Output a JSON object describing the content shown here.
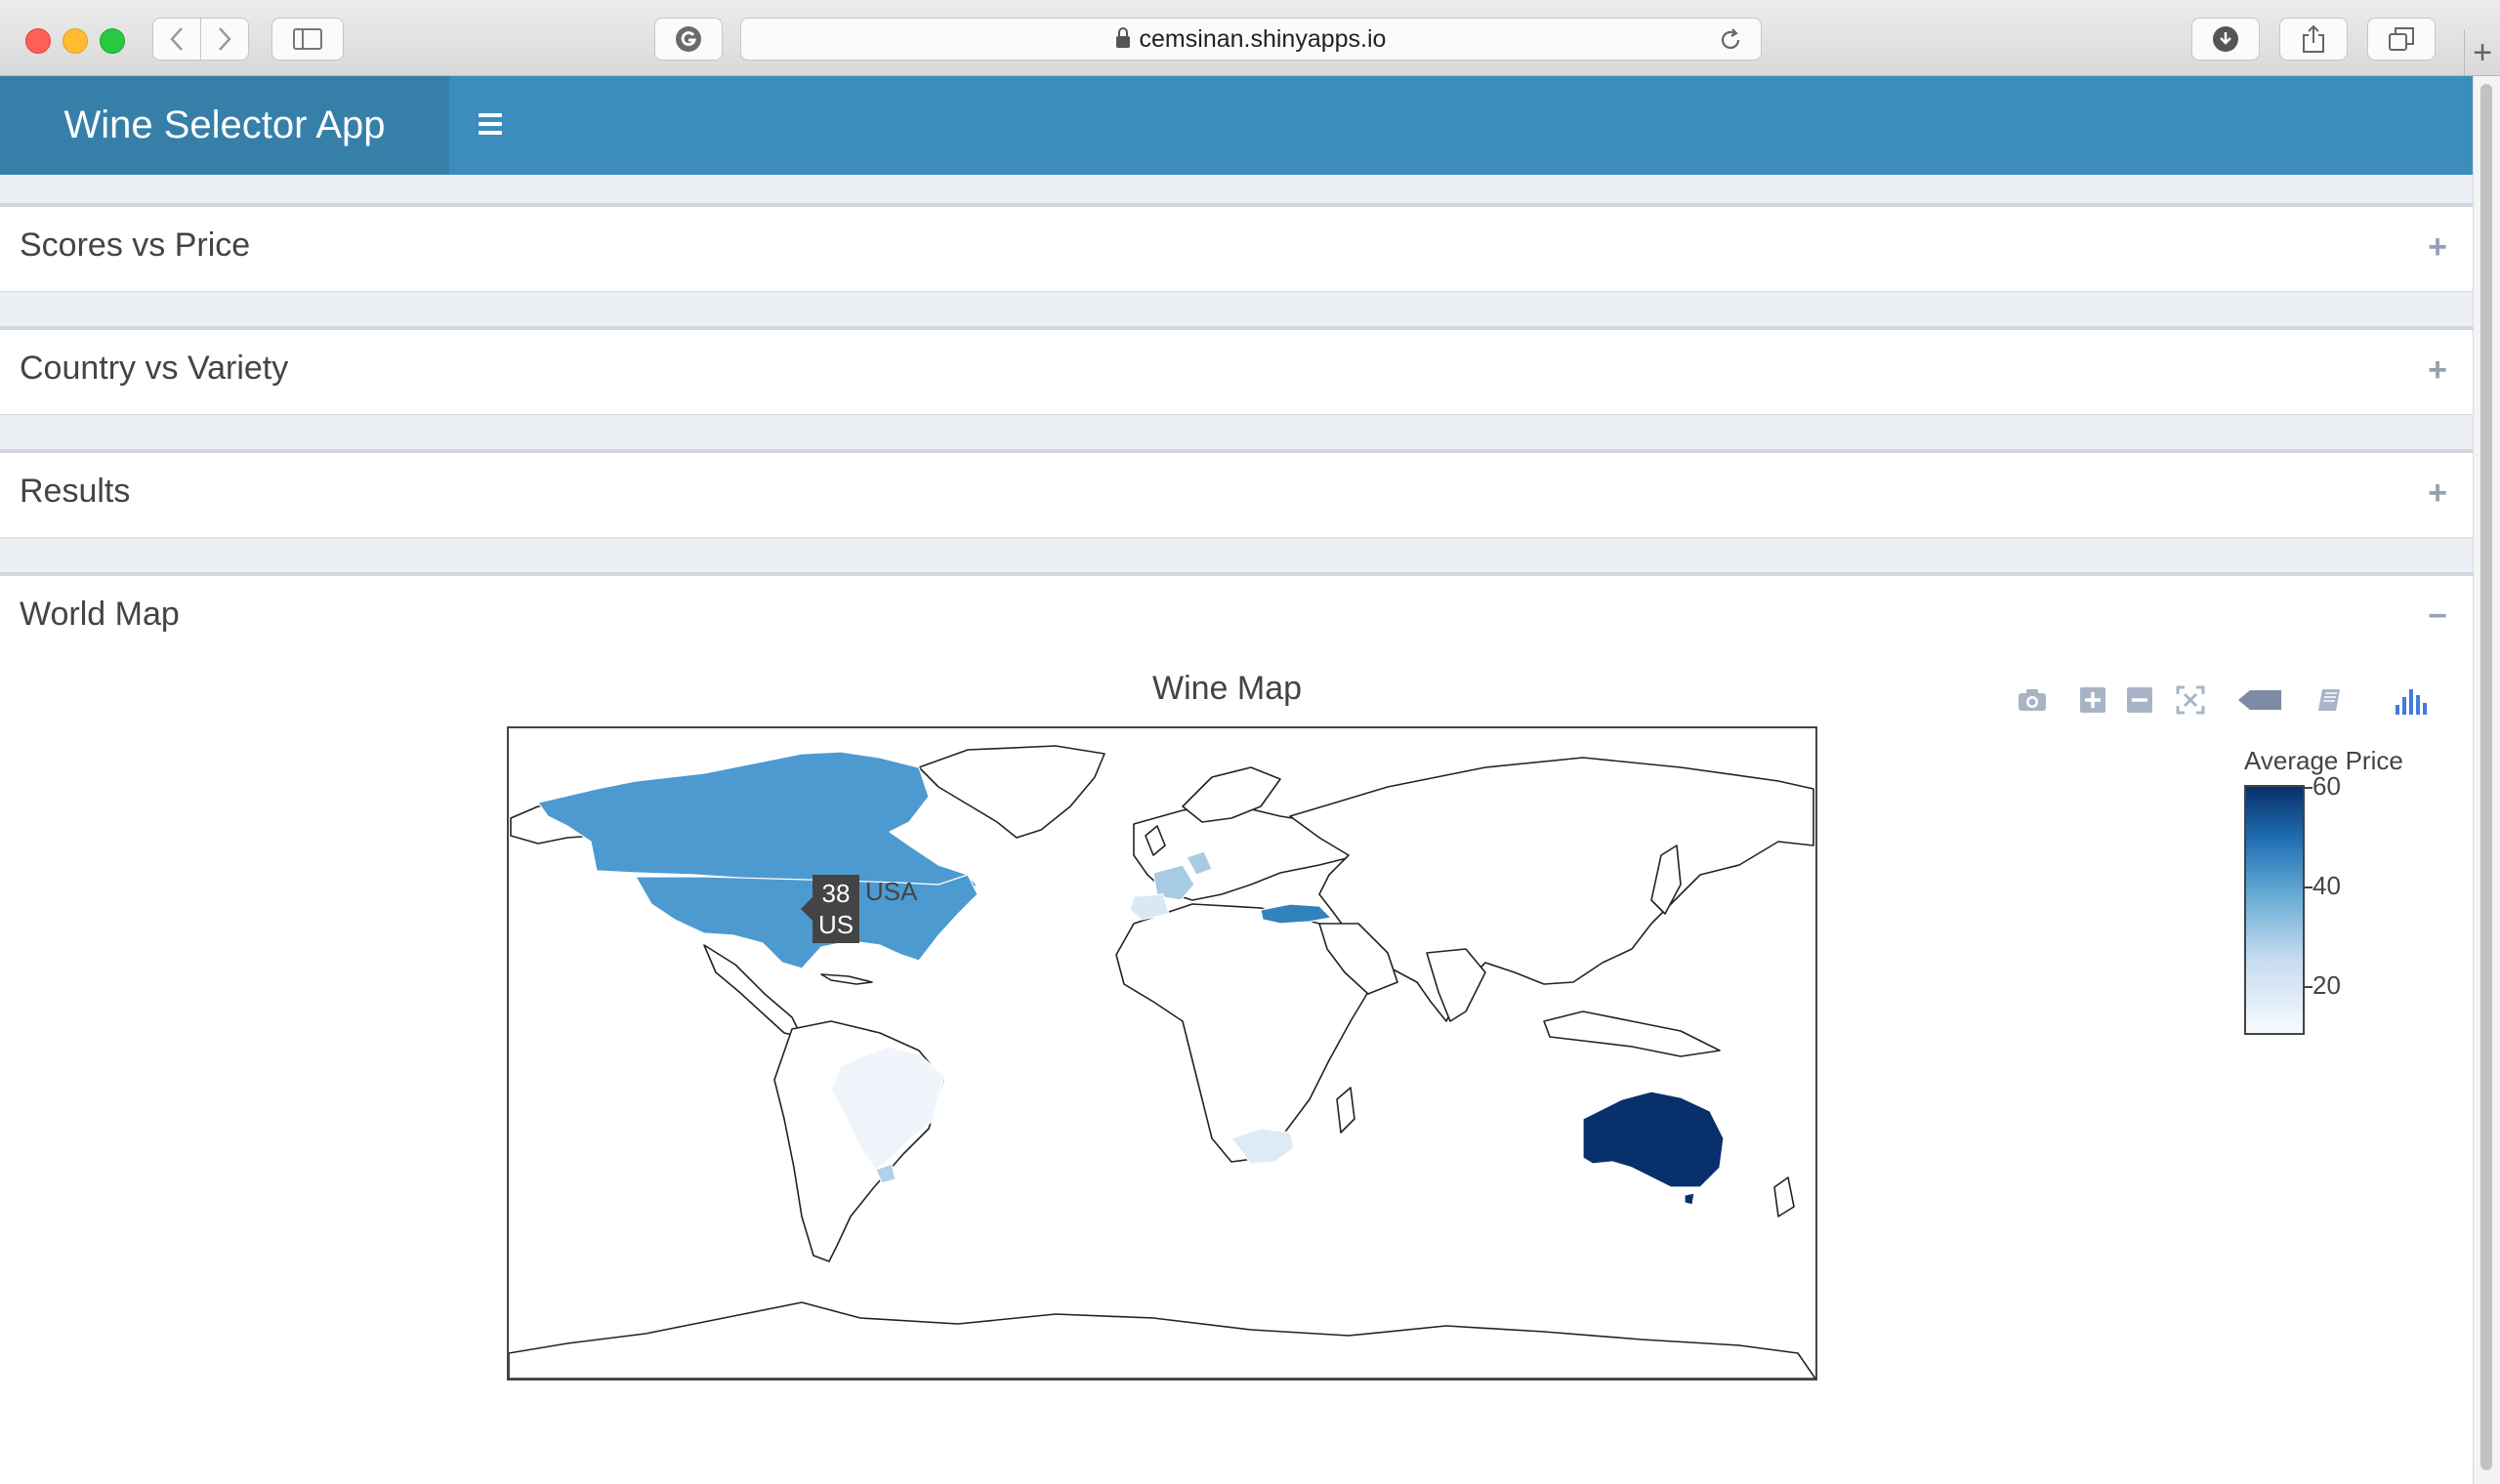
{
  "browser": {
    "url": "cemsinan.shinyapps.io"
  },
  "app": {
    "title": "Wine Selector App"
  },
  "boxes": [
    {
      "title": "Scores vs Price",
      "tool": "+"
    },
    {
      "title": "Country vs Variety",
      "tool": "+"
    },
    {
      "title": "Results",
      "tool": "+"
    },
    {
      "title": "World Map",
      "tool": "−"
    }
  ],
  "map": {
    "title": "Wine Map",
    "colorbar_title": "Average Price",
    "colorbar_ticks": [
      "60",
      "40",
      "20"
    ],
    "colorscale": [
      "#f7fbff",
      "#c6dbef",
      "#6baed6",
      "#2171b5",
      "#08306b"
    ],
    "tooltip": {
      "value": "38",
      "code": "US",
      "name": "USA"
    }
  },
  "chart_data": {
    "type": "choropleth",
    "title": "Wine Map",
    "colorbar_title": "Average Price",
    "colorbar_range": [
      10,
      60
    ],
    "regions": [
      {
        "code": "US",
        "name": "USA",
        "value": 38
      },
      {
        "code": "CA",
        "value": 37
      },
      {
        "code": "AU",
        "value": 60
      },
      {
        "code": "TR",
        "value": 45
      },
      {
        "code": "BR",
        "value": 12
      },
      {
        "code": "FR",
        "value": 25
      },
      {
        "code": "ES",
        "value": 20
      },
      {
        "code": "ZA",
        "value": 18
      },
      {
        "code": "UY",
        "value": 25
      }
    ]
  }
}
